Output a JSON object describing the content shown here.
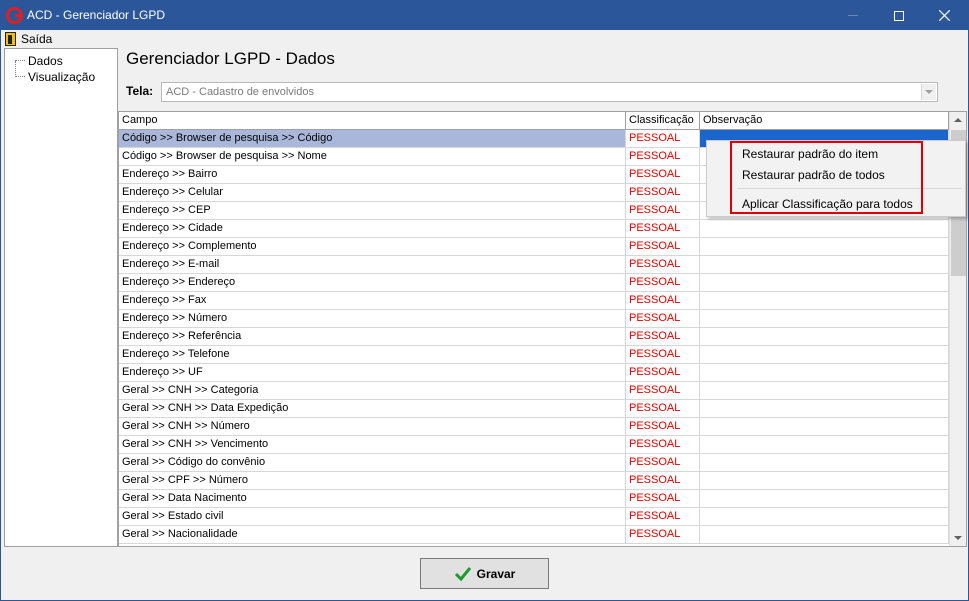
{
  "window": {
    "title": "ACD - Gerenciador LGPD"
  },
  "menu": {
    "exit_label": "Saída"
  },
  "tree": {
    "items": [
      "Dados",
      "Visualização"
    ]
  },
  "page": {
    "title": "Gerenciador LGPD - Dados",
    "tela_label": "Tela:",
    "tela_value": "ACD - Cadastro de envolvidos"
  },
  "grid": {
    "headers": {
      "campo": "Campo",
      "classificacao": "Classificação",
      "observacao": "Observação"
    },
    "rows": [
      {
        "campo": "Código >> Browser de pesquisa >> Código",
        "classificacao": "PESSOAL",
        "observacao": ""
      },
      {
        "campo": "Código >> Browser de pesquisa >> Nome",
        "classificacao": "PESSOAL",
        "observacao": ""
      },
      {
        "campo": "Endereço >> Bairro",
        "classificacao": "PESSOAL",
        "observacao": ""
      },
      {
        "campo": "Endereço >> Celular",
        "classificacao": "PESSOAL",
        "observacao": ""
      },
      {
        "campo": "Endereço >> CEP",
        "classificacao": "PESSOAL",
        "observacao": ""
      },
      {
        "campo": "Endereço >> Cidade",
        "classificacao": "PESSOAL",
        "observacao": ""
      },
      {
        "campo": "Endereço >> Complemento",
        "classificacao": "PESSOAL",
        "observacao": ""
      },
      {
        "campo": "Endereço >> E-mail",
        "classificacao": "PESSOAL",
        "observacao": ""
      },
      {
        "campo": "Endereço >> Endereço",
        "classificacao": "PESSOAL",
        "observacao": ""
      },
      {
        "campo": "Endereço >> Fax",
        "classificacao": "PESSOAL",
        "observacao": ""
      },
      {
        "campo": "Endereço >> Número",
        "classificacao": "PESSOAL",
        "observacao": ""
      },
      {
        "campo": "Endereço >> Referência",
        "classificacao": "PESSOAL",
        "observacao": ""
      },
      {
        "campo": "Endereço >> Telefone",
        "classificacao": "PESSOAL",
        "observacao": ""
      },
      {
        "campo": "Endereço >> UF",
        "classificacao": "PESSOAL",
        "observacao": ""
      },
      {
        "campo": "Geral >> CNH >> Categoria",
        "classificacao": "PESSOAL",
        "observacao": ""
      },
      {
        "campo": "Geral >> CNH >> Data Expedição",
        "classificacao": "PESSOAL",
        "observacao": ""
      },
      {
        "campo": "Geral >> CNH >> Número",
        "classificacao": "PESSOAL",
        "observacao": ""
      },
      {
        "campo": "Geral >> CNH >> Vencimento",
        "classificacao": "PESSOAL",
        "observacao": ""
      },
      {
        "campo": "Geral >> Código do convênio",
        "classificacao": "PESSOAL",
        "observacao": ""
      },
      {
        "campo": "Geral >> CPF >> Número",
        "classificacao": "PESSOAL",
        "observacao": ""
      },
      {
        "campo": "Geral >> Data Nacimento",
        "classificacao": "PESSOAL",
        "observacao": ""
      },
      {
        "campo": "Geral >> Estado civil",
        "classificacao": "PESSOAL",
        "observacao": ""
      },
      {
        "campo": "Geral >> Nacionalidade",
        "classificacao": "PESSOAL",
        "observacao": ""
      }
    ],
    "selected_row": 0
  },
  "context_menu": {
    "items": [
      "Restaurar padrão do item",
      "Restaurar padrão de todos",
      "Aplicar Classificação para todos"
    ]
  },
  "footer": {
    "save_label": "Gravar"
  },
  "colors": {
    "titlebar": "#2b579a",
    "selection": "#a9b8da",
    "classification_text": "#e00000",
    "highlight_border": "#e00000"
  }
}
